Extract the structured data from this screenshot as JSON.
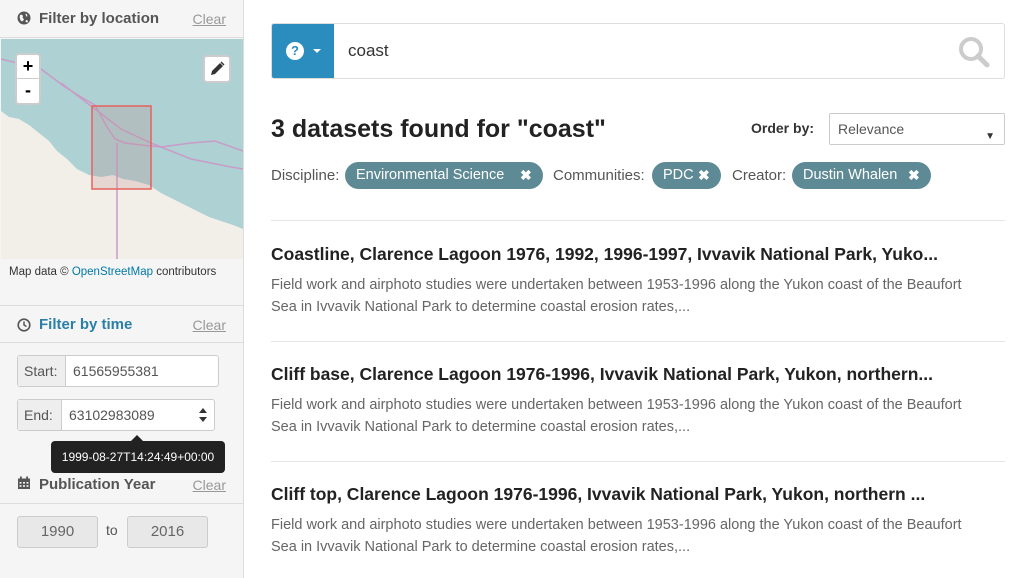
{
  "sidebar": {
    "location": {
      "title": "Filter by location",
      "clear": "Clear"
    },
    "map": {
      "zoom_in": "+",
      "zoom_out": "-",
      "attribution_prefix": "Map data © ",
      "attribution_link": "OpenStreetMap",
      "attribution_suffix": " contributors"
    },
    "time": {
      "title": "Filter by time",
      "clear": "Clear",
      "start_label": "Start:",
      "start_value": "61565955381",
      "end_label": "End:",
      "end_value": "63102983089",
      "tooltip": "1999-08-27T14:24:49+00:00"
    },
    "publication": {
      "title": "Publication Year",
      "clear": "Clear",
      "from": "1990",
      "to_label": "to",
      "to": "2016"
    }
  },
  "search": {
    "query": "coast",
    "help": "?"
  },
  "results": {
    "heading": "3 datasets found for \"coast\"",
    "order_label": "Order by:",
    "order_value": "Relevance",
    "facets": [
      {
        "label": "Discipline:",
        "chip": "Environmental Science"
      },
      {
        "label": "Communities:",
        "chip": "PDC"
      },
      {
        "label": "Creator:",
        "chip": "Dustin Whalen"
      }
    ],
    "items": [
      {
        "title": "Coastline, Clarence Lagoon 1976, 1992, 1996-1997, Ivvavik National Park, Yuko...",
        "desc": "Field work and airphoto studies were undertaken between 1953-1996 along the Yukon coast of the Beaufort Sea in Ivvavik National Park to determine coastal erosion rates,..."
      },
      {
        "title": "Cliff base, Clarence Lagoon 1976-1996, Ivvavik National Park, Yukon, northern...",
        "desc": "Field work and airphoto studies were undertaken between 1953-1996 along the Yukon coast of the Beaufort Sea in Ivvavik National Park to determine coastal erosion rates,..."
      },
      {
        "title": "Cliff top, Clarence Lagoon 1976-1996, Ivvavik National Park, Yukon, northern ...",
        "desc": "Field work and airphoto studies were undertaken between 1953-1996 along the Yukon coast of the Beaufort Sea in Ivvavik National Park to determine coastal erosion rates,..."
      }
    ]
  },
  "colors": {
    "accent": "#2b8cbe",
    "chip": "#5d8a95",
    "filter_time_title": "#2b7ea6",
    "map_water": "#aed1d3",
    "map_land": "#f2efe9",
    "bbox": "#e8605c"
  }
}
